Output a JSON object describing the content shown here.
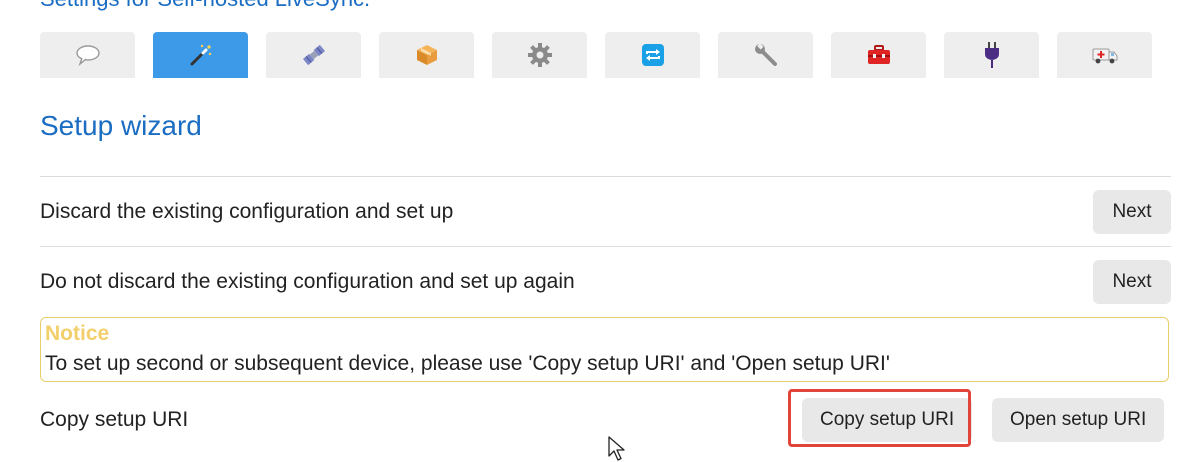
{
  "header": {
    "title": "Settings for Self-hosted LiveSync."
  },
  "tabs": [
    {
      "icon": "speech-bubble-icon",
      "active": false
    },
    {
      "icon": "magic-wand-icon",
      "active": true
    },
    {
      "icon": "satellite-icon",
      "active": false
    },
    {
      "icon": "package-icon",
      "active": false
    },
    {
      "icon": "gear-icon",
      "active": false
    },
    {
      "icon": "sync-icon",
      "active": false
    },
    {
      "icon": "wrench-icon",
      "active": false
    },
    {
      "icon": "toolbox-icon",
      "active": false
    },
    {
      "icon": "plug-icon",
      "active": false
    },
    {
      "icon": "ambulance-icon",
      "active": false
    }
  ],
  "section": {
    "title": "Setup wizard"
  },
  "rows": [
    {
      "label": "Discard the existing configuration and set up",
      "button": "Next"
    },
    {
      "label": "Do not discard the existing configuration and set up again",
      "button": "Next"
    }
  ],
  "notice": {
    "title": "Notice",
    "text": "To set up second or subsequent device, please use 'Copy setup URI' and 'Open setup URI'"
  },
  "uri_row": {
    "label": "Copy setup URI",
    "copy_button": "Copy setup URI",
    "open_button": "Open setup URI"
  },
  "colors": {
    "accent": "#3d9ae8",
    "title": "#1a6dc2",
    "notice_border": "#e8cf6a",
    "notice_title": "#f2cf6b",
    "highlight": "#e0443a"
  }
}
